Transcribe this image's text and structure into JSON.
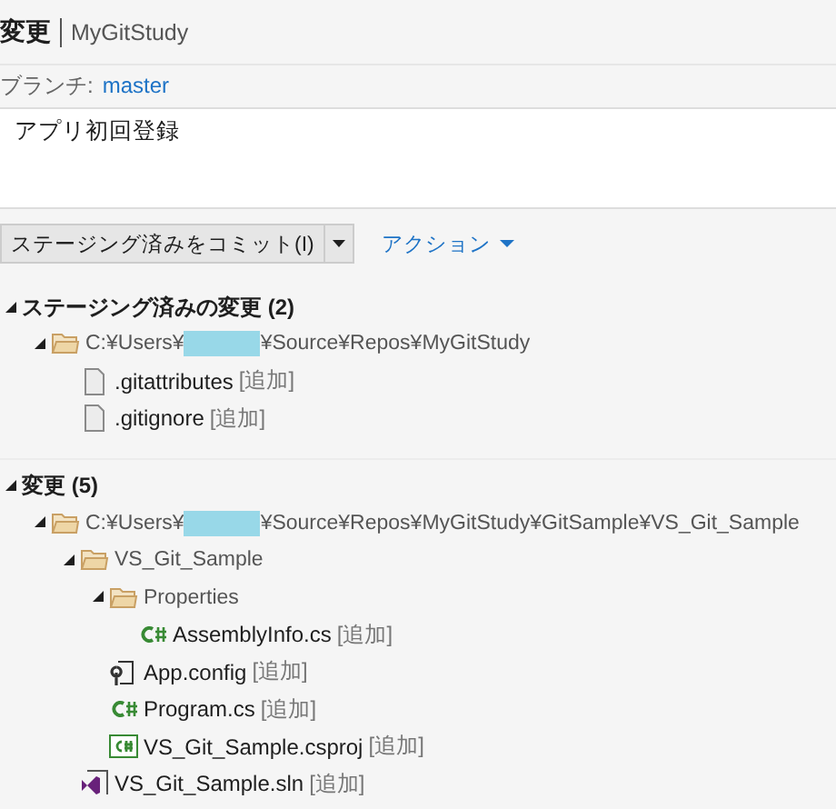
{
  "header": {
    "title": "変更",
    "repo": "MyGitStudy"
  },
  "branch": {
    "label": "ブランチ:",
    "name": "master"
  },
  "commit_message": {
    "value": "アプリ初回登録"
  },
  "commit_button": {
    "label": "ステージング済みをコミット(I)"
  },
  "actions_link": {
    "label": "アクション"
  },
  "sections": [
    {
      "title": "ステージング済みの変更 (2)",
      "expanded": true,
      "tree": [
        {
          "kind": "folder",
          "path_before": "C:¥Users¥",
          "redacted": true,
          "path_after": "¥Source¥Repos¥MyGitStudy",
          "expanded": true,
          "children": [
            {
              "kind": "file",
              "name": ".gitattributes",
              "status": "[追加]"
            },
            {
              "kind": "file",
              "name": ".gitignore",
              "status": "[追加]"
            }
          ]
        }
      ]
    },
    {
      "title": "変更 (5)",
      "expanded": true,
      "tree": [
        {
          "kind": "folder",
          "path_before": "C:¥Users¥",
          "redacted": true,
          "path_after": "¥Source¥Repos¥MyGitStudy¥GitSample¥VS_Git_Sample",
          "expanded": true,
          "children": [
            {
              "kind": "folder",
              "name": "VS_Git_Sample",
              "expanded": true,
              "children": [
                {
                  "kind": "folder",
                  "name": "Properties",
                  "expanded": true,
                  "children": [
                    {
                      "kind": "cs",
                      "name": "AssemblyInfo.cs",
                      "status": "[追加]"
                    }
                  ]
                },
                {
                  "kind": "config",
                  "name": "App.config",
                  "status": "[追加]"
                },
                {
                  "kind": "cs",
                  "name": "Program.cs",
                  "status": "[追加]"
                },
                {
                  "kind": "csproj",
                  "name": "VS_Git_Sample.csproj",
                  "status": "[追加]"
                }
              ]
            },
            {
              "kind": "sln",
              "name": "VS_Git_Sample.sln",
              "status": "[追加]"
            }
          ]
        }
      ]
    }
  ]
}
